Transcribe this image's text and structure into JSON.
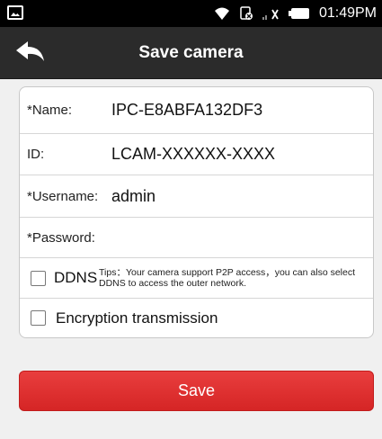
{
  "status_bar": {
    "time": "01:49PM",
    "icons": [
      "picture-icon",
      "wifi-icon",
      "sim-off-icon",
      "signal-icon",
      "battery-icon"
    ]
  },
  "header": {
    "title": "Save camera",
    "back_icon": "back-arrow-icon"
  },
  "form": {
    "name": {
      "label": "*Name:",
      "value": "IPC-E8ABFA132DF3"
    },
    "id": {
      "label": "ID:",
      "value": "LCAM-XXXXXX-XXXX"
    },
    "username": {
      "label": "*Username:",
      "value": "admin"
    },
    "password": {
      "label": "*Password:",
      "value": ""
    },
    "ddns": {
      "label": "DDNS",
      "checked": false,
      "tips": "Tips：Your camera support P2P access，you can also select DDNS to access the outer network."
    },
    "encryption": {
      "label": "Encryption transmission",
      "checked": false
    }
  },
  "save_button": {
    "label": "Save"
  },
  "colors": {
    "header_bg": "#2b2b2b",
    "save_button_bg": "#e03030",
    "page_bg": "#f0f0f0"
  }
}
